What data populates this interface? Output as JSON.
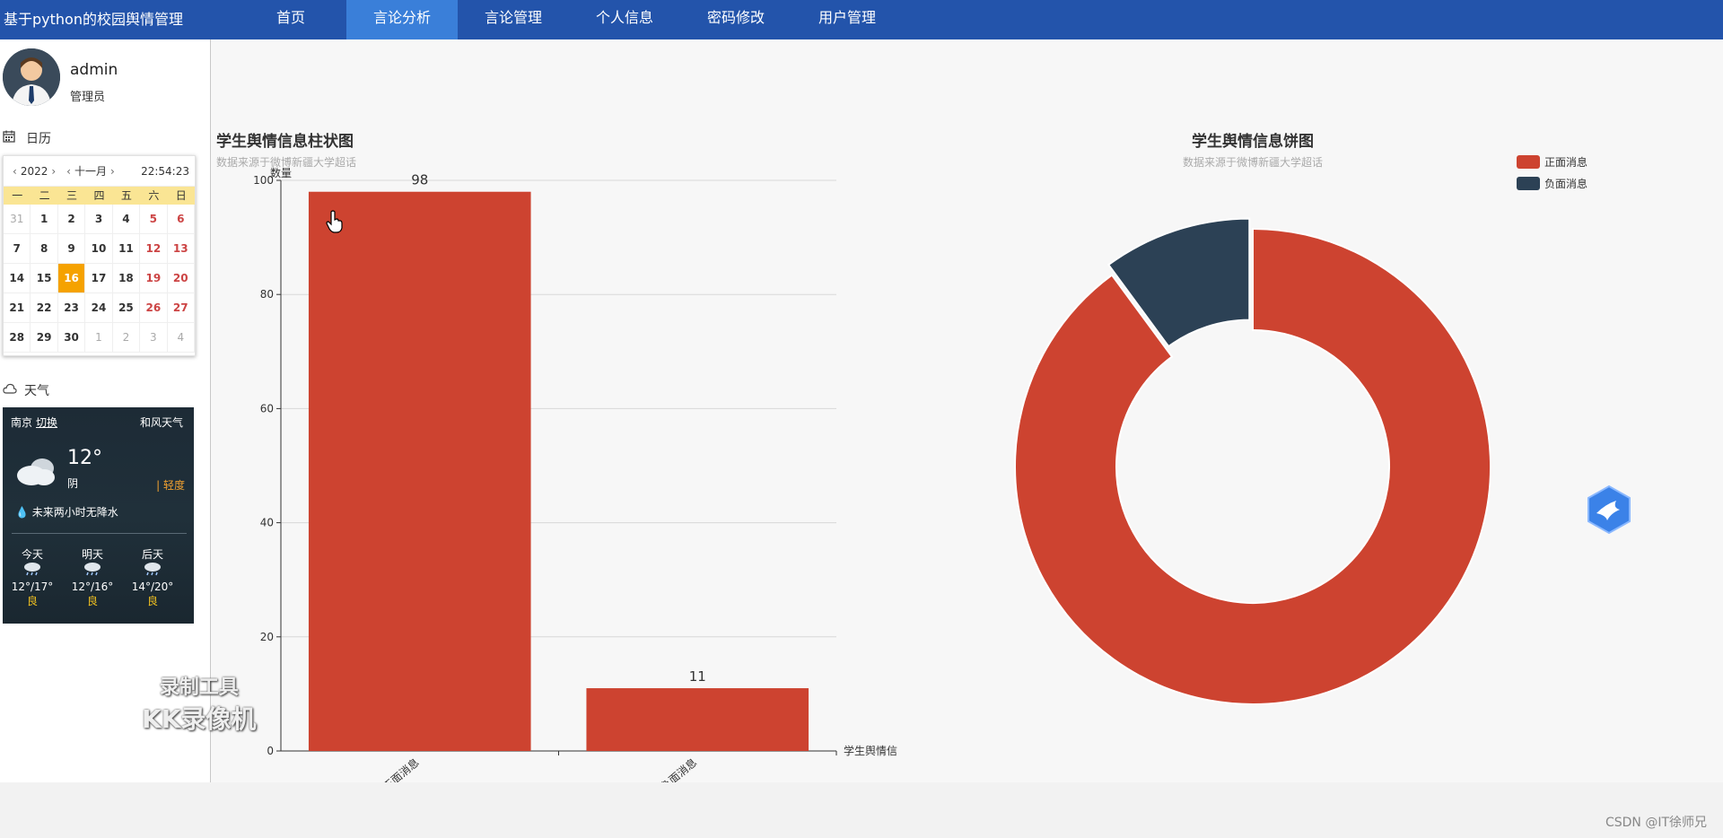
{
  "app": {
    "title": "基于python的校园舆情管理"
  },
  "nav": [
    {
      "label": "首页",
      "active": false
    },
    {
      "label": "言论分析",
      "active": true
    },
    {
      "label": "言论管理",
      "active": false
    },
    {
      "label": "个人信息",
      "active": false
    },
    {
      "label": "密码修改",
      "active": false
    },
    {
      "label": "用户管理",
      "active": false
    }
  ],
  "user": {
    "name": "admin",
    "role": "管理员"
  },
  "calendar": {
    "section_label": "日历",
    "year": "2022",
    "month": "十一月",
    "time": "22:54:23",
    "weekdays": [
      "一",
      "二",
      "三",
      "四",
      "五",
      "六",
      "日"
    ],
    "days": [
      [
        "31",
        "1",
        "2",
        "3",
        "4",
        "5",
        "6"
      ],
      [
        "7",
        "8",
        "9",
        "10",
        "11",
        "12",
        "13"
      ],
      [
        "14",
        "15",
        "16",
        "17",
        "18",
        "19",
        "20"
      ],
      [
        "21",
        "22",
        "23",
        "24",
        "25",
        "26",
        "27"
      ],
      [
        "28",
        "29",
        "30",
        "1",
        "2",
        "3",
        "4"
      ]
    ],
    "today": "16"
  },
  "weather": {
    "section_label": "天气",
    "city": "南京",
    "switch": "切换",
    "provider": "和风天气",
    "temp": "12°",
    "condition": "阴",
    "aqi": "轻度",
    "rain_note": "未来两小时无降水",
    "forecast": [
      {
        "day": "今天",
        "range": "12°/17°",
        "aq": "良"
      },
      {
        "day": "明天",
        "range": "12°/16°",
        "aq": "良"
      },
      {
        "day": "后天",
        "range": "14°/20°",
        "aq": "良"
      }
    ]
  },
  "watermark": {
    "line1": "录制工具",
    "line2": "KK录像机"
  },
  "footer": {
    "credit": "CSDN @IT徐师兄"
  },
  "colors": {
    "positive": "#cd4330",
    "negative": "#2c4155",
    "nav": "#2354ab",
    "nav_active": "#3a7fd9"
  },
  "chart_data": [
    {
      "type": "bar",
      "title": "学生舆情信息柱状图",
      "subtitle": "数据来源于微博新疆大学超话",
      "ylabel": "数量",
      "xlabel": "学生舆情信",
      "categories": [
        "正面消息",
        "负面消息"
      ],
      "values": [
        98,
        11
      ],
      "ylim": [
        0,
        100
      ],
      "yticks": [
        0,
        20,
        40,
        60,
        80,
        100
      ],
      "grid": true
    },
    {
      "type": "pie",
      "title": "学生舆情信息饼图",
      "subtitle": "数据来源于微博新疆大学超话",
      "labels": [
        "正面消息",
        "负面消息"
      ],
      "values": [
        98,
        11
      ],
      "legend": "top-right",
      "donut": true
    }
  ]
}
